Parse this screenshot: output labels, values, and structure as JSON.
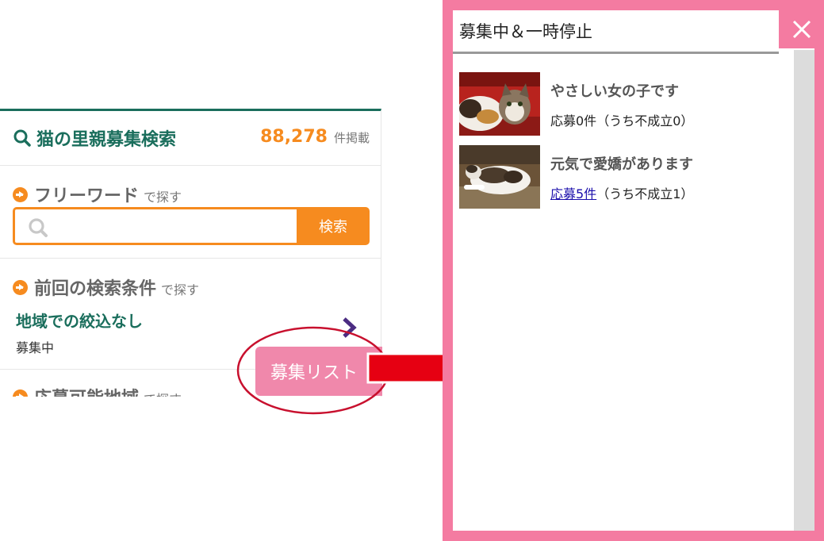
{
  "search_panel": {
    "title": "猫の里親募集検索",
    "count": "88,278",
    "count_unit": "件掲載",
    "freeword": {
      "title": "フリーワード",
      "suffix": "で探す",
      "input_value": "",
      "button_label": "検索"
    },
    "previous": {
      "title": "前回の検索条件",
      "suffix": "で探す",
      "value": "地域での絞込なし",
      "status": "募集中"
    },
    "area": {
      "title": "応募可能地域",
      "suffix": "で探す"
    },
    "list_button_label": "募集リスト"
  },
  "popup": {
    "title": "募集中＆一時停止",
    "close_icon": "close-icon",
    "items": [
      {
        "name": "やさしい女の子です",
        "apply_label": "応募0件",
        "apply_is_link": false,
        "note": "（うち不成立0）"
      },
      {
        "name": "元気で愛嬌があります",
        "apply_label": "応募5件",
        "apply_is_link": true,
        "note": "（うち不成立1）"
      }
    ]
  },
  "colors": {
    "brand_green": "#1a6e5c",
    "accent_orange": "#f68b1f",
    "popup_pink": "#f47ba1",
    "list_button_pink": "#f088ab",
    "annotation_red": "#e60012"
  }
}
